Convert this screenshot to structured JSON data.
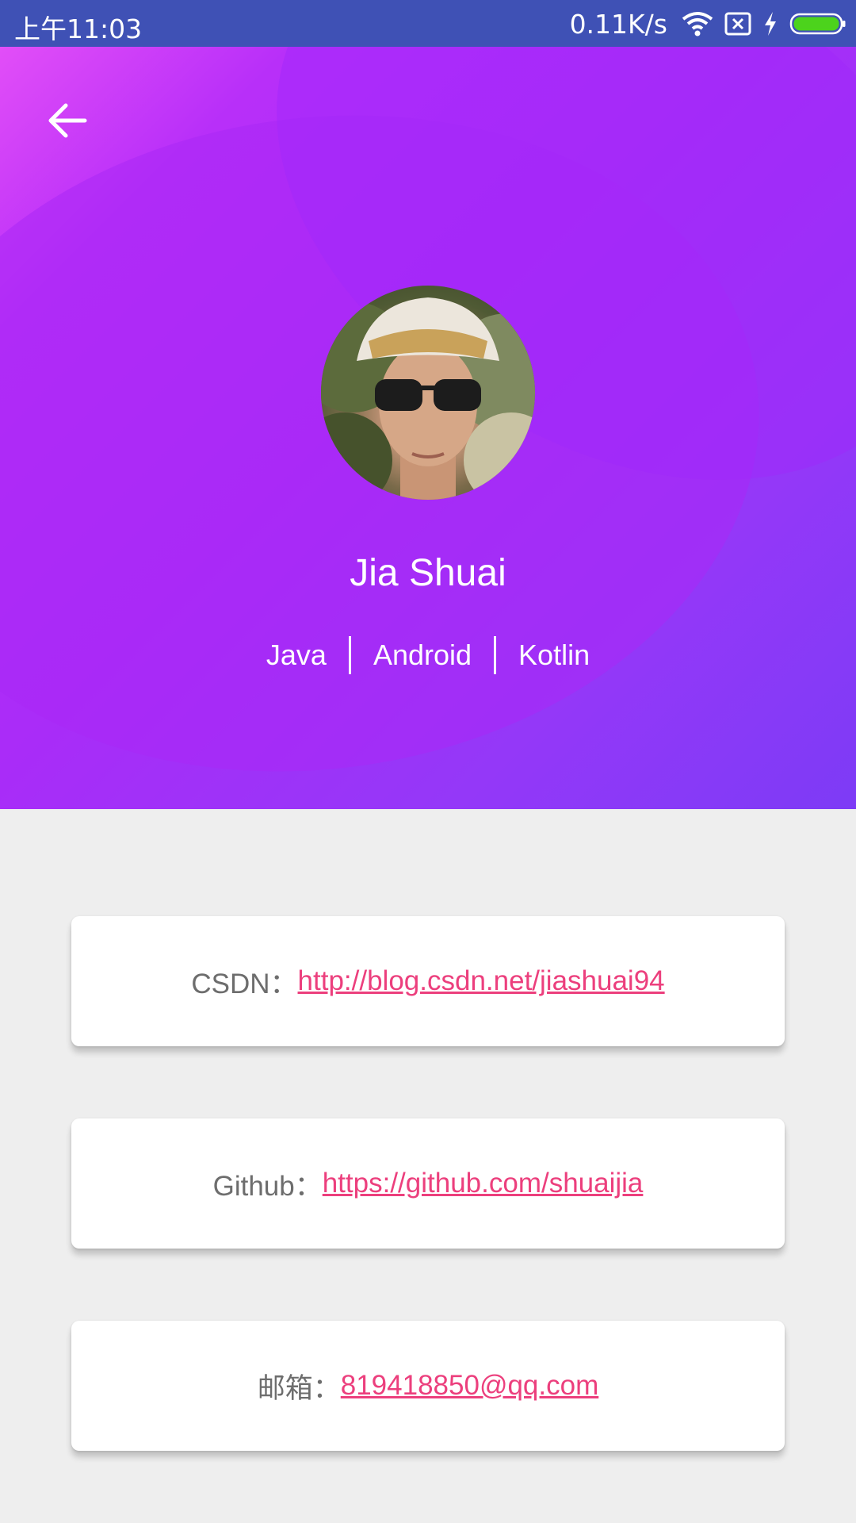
{
  "status_bar": {
    "time": "上午11:03",
    "net_speed": "0.11K/s",
    "icons": [
      "wifi-icon",
      "no-sim-icon",
      "charging-icon",
      "battery-icon"
    ]
  },
  "header": {
    "back_icon": "back-arrow-icon",
    "name": "Jia Shuai",
    "tags": [
      "Java",
      "Android",
      "Kotlin"
    ]
  },
  "links": [
    {
      "label": "CSDN：",
      "value": "http://blog.csdn.net/jiashuai94"
    },
    {
      "label": "Github：",
      "value": "https://github.com/shuaijia"
    },
    {
      "label": "邮箱：",
      "value": "819418850@qq.com"
    }
  ],
  "colors": {
    "status_bar": "#3f51b5",
    "header_gradient_start": "#e24ef8",
    "header_gradient_end": "#7d3bf6",
    "link": "#ec3f7d",
    "label": "#6d6d6d",
    "background": "#eeeeee"
  }
}
